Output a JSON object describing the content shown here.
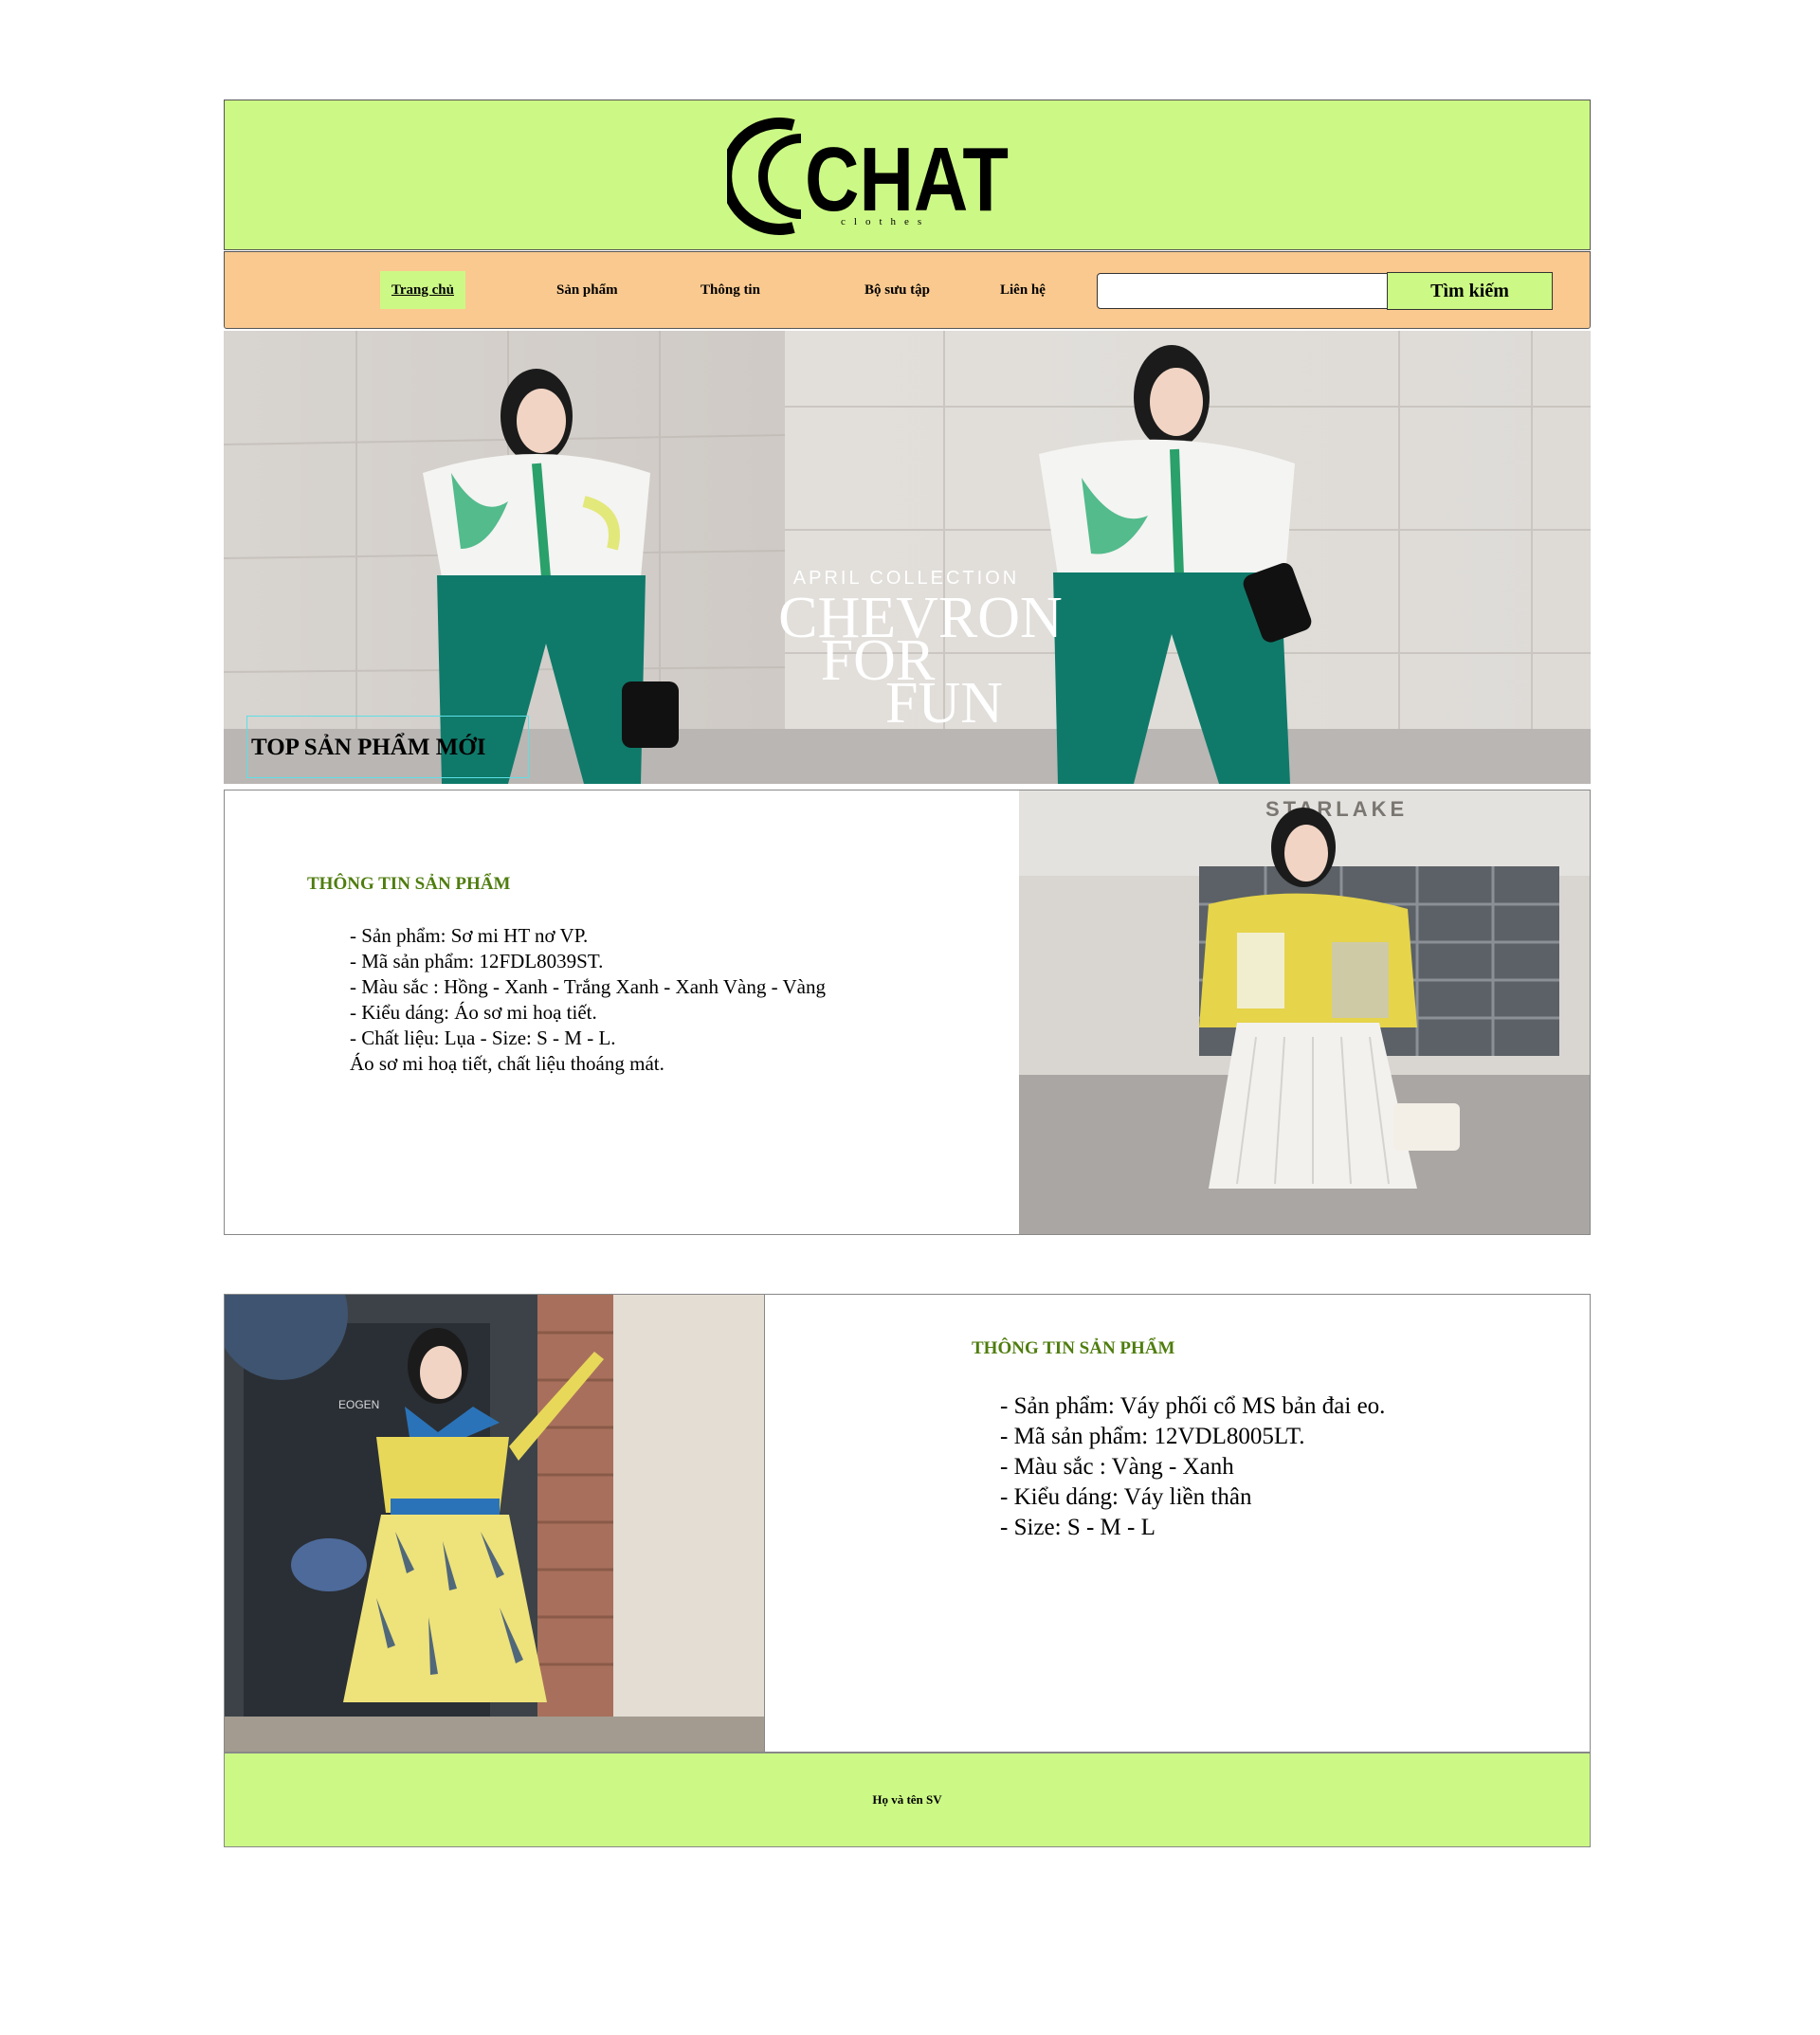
{
  "brand": {
    "logo_text": "CHAT",
    "logo_subtext": "clothes"
  },
  "nav": {
    "items": [
      {
        "label": "Trang chủ",
        "active": true
      },
      {
        "label": "Sản phẩm"
      },
      {
        "label": "Thông tin"
      },
      {
        "label": "Bộ sưu tập"
      },
      {
        "label": "Liên hệ"
      }
    ],
    "search_value": "",
    "search_button": "Tìm kiếm"
  },
  "banner": {
    "kicker": "APRIL COLLECTION",
    "headline_1": "CHEVRON",
    "headline_2": "FOR",
    "headline_3": "FUN"
  },
  "section_title": "TOP SẢN PHẨM MỚI",
  "products": [
    {
      "heading": "THÔNG TIN SẢN PHẨM",
      "lines": [
        "- Sản phẩm: Sơ mi HT nơ VP.",
        "- Mã sản phẩm: 12FDL8039ST.",
        "- Màu sắc : Hồng - Xanh - Trắng Xanh - Xanh Vàng - Vàng",
        "- Kiểu dáng: Áo sơ mi hoạ tiết.",
        "- Chất liệu: Lụa  - Size: S - M - L.",
        "Áo sơ mi hoạ tiết, chất liệu thoáng mát."
      ],
      "photo_sign": "STARLAKE"
    },
    {
      "heading": "THÔNG TIN SẢN PHẨM",
      "lines": [
        "- Sản phẩm: Váy phối cổ MS bản đai eo.",
        "- Mã sản phẩm: 12VDL8005LT.",
        "- Màu sắc : Vàng - Xanh",
        "- Kiểu dáng: Váy liền thân",
        "- Size: S - M - L"
      ],
      "photo_sign": "EOGEN"
    }
  ],
  "footer": {
    "text": "Họ và tên SV"
  },
  "colors": {
    "header_bg": "#ccf985",
    "nav_bg": "#fac98f",
    "heading_green": "#4f7d0f",
    "title_border": "#5de0e6"
  }
}
